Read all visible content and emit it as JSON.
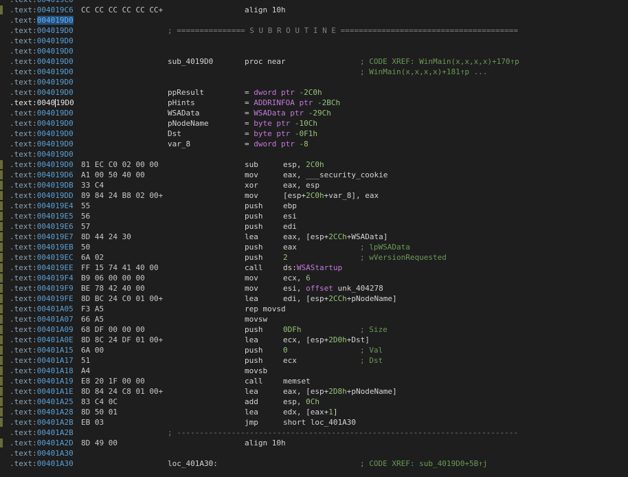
{
  "listing": {
    "segment": ".text:",
    "lines": [
      {
        "addr": "004019C0",
        "bytes": "",
        "label": "",
        "mnem": "",
        "ops": "",
        "cmt": "",
        "partial": true
      },
      {
        "addr": "004019C6",
        "bytes": "CC CC CC CC CC CC+",
        "mnem": "align 10h",
        "code": true
      },
      {
        "addr": "004019D0",
        "sel": true
      },
      {
        "addr": "004019D0",
        "sep": "; =============== S U B R O U T I N E ======================================="
      },
      {
        "addr": "004019D0"
      },
      {
        "addr": "004019D0"
      },
      {
        "addr": "004019D0",
        "label": "sub_4019D0",
        "mnem": "proc near",
        "cmt": "; CODE XREF: WinMain(x,x,x,x)+170↑p"
      },
      {
        "addr": "004019D0",
        "cmt": "; WinMain(x,x,x,x)+181↑p ..."
      },
      {
        "addr": "004019D0"
      },
      {
        "addr": "004019D0",
        "label": "ppResult",
        "mnem": "= dword ptr -2C0h",
        "mnemCls": "o-sym"
      },
      {
        "addr": "004019D0",
        "label": "pHints",
        "mnem": "= ADDRINFOA ptr -2BCh",
        "mnemCls": "o-sym",
        "current": true
      },
      {
        "addr": "004019D0",
        "label": "WSAData",
        "mnem": "= WSAData ptr -29Ch",
        "mnemCls": "o-sym"
      },
      {
        "addr": "004019D0",
        "label": "pNodeName",
        "mnem": "= byte ptr -10Ch",
        "mnemCls": "o-sym"
      },
      {
        "addr": "004019D0",
        "label": "Dst",
        "mnem": "= byte ptr -0F1h",
        "mnemCls": "o-sym"
      },
      {
        "addr": "004019D0",
        "label": "var_8",
        "mnem": "= dword ptr -8",
        "mnemCls": "o-sym"
      },
      {
        "addr": "004019D0"
      },
      {
        "addr": "004019D0",
        "bytes": "81 EC C0 02 00 00",
        "mnem": "sub",
        "ops": "esp, 2C0h",
        "code": true
      },
      {
        "addr": "004019D6",
        "bytes": "A1 00 50 40 00",
        "mnem": "mov",
        "ops": "eax, ___security_cookie",
        "code": true
      },
      {
        "addr": "004019DB",
        "bytes": "33 C4",
        "mnem": "xor",
        "ops": "eax, esp",
        "code": true
      },
      {
        "addr": "004019DD",
        "bytes": "89 84 24 B8 02 00+",
        "mnem": "mov",
        "ops": "[esp+2C0h+var_8], eax",
        "code": true
      },
      {
        "addr": "004019E4",
        "bytes": "55",
        "mnem": "push",
        "ops": "ebp",
        "code": true
      },
      {
        "addr": "004019E5",
        "bytes": "56",
        "mnem": "push",
        "ops": "esi",
        "code": true
      },
      {
        "addr": "004019E6",
        "bytes": "57",
        "mnem": "push",
        "ops": "edi",
        "code": true
      },
      {
        "addr": "004019E7",
        "bytes": "8D 44 24 30",
        "mnem": "lea",
        "ops": "eax, [esp+2CCh+WSAData]",
        "code": true
      },
      {
        "addr": "004019EB",
        "bytes": "50",
        "mnem": "push",
        "ops": "eax",
        "cmt": "; lpWSAData",
        "code": true
      },
      {
        "addr": "004019EC",
        "bytes": "6A 02",
        "mnem": "push",
        "ops": "2",
        "cmt": "; wVersionRequested",
        "code": true
      },
      {
        "addr": "004019EE",
        "bytes": "FF 15 74 41 40 00",
        "mnem": "call",
        "ops": "ds:WSAStartup",
        "code": true
      },
      {
        "addr": "004019F4",
        "bytes": "B9 06 00 00 00",
        "mnem": "mov",
        "ops": "ecx, 6",
        "code": true
      },
      {
        "addr": "004019F9",
        "bytes": "BE 78 42 40 00",
        "mnem": "mov",
        "ops": "esi, offset unk_404278",
        "code": true
      },
      {
        "addr": "004019FE",
        "bytes": "8D BC 24 C0 01 00+",
        "mnem": "lea",
        "ops": "edi, [esp+2CCh+pNodeName]",
        "code": true
      },
      {
        "addr": "00401A05",
        "bytes": "F3 A5",
        "mnem": "rep movsd",
        "ops": "",
        "code": true
      },
      {
        "addr": "00401A07",
        "bytes": "66 A5",
        "mnem": "movsw",
        "ops": "",
        "code": true
      },
      {
        "addr": "00401A09",
        "bytes": "68 DF 00 00 00",
        "mnem": "push",
        "ops": "0DFh",
        "cmt": "; Size",
        "code": true
      },
      {
        "addr": "00401A0E",
        "bytes": "8D 8C 24 DF 01 00+",
        "mnem": "lea",
        "ops": "ecx, [esp+2D0h+Dst]",
        "code": true
      },
      {
        "addr": "00401A15",
        "bytes": "6A 00",
        "mnem": "push",
        "ops": "0",
        "cmt": "; Val",
        "code": true
      },
      {
        "addr": "00401A17",
        "bytes": "51",
        "mnem": "push",
        "ops": "ecx",
        "cmt": "; Dst",
        "code": true
      },
      {
        "addr": "00401A18",
        "bytes": "A4",
        "mnem": "movsb",
        "ops": "",
        "code": true
      },
      {
        "addr": "00401A19",
        "bytes": "E8 20 1F 00 00",
        "mnem": "call",
        "ops": "memset",
        "code": true
      },
      {
        "addr": "00401A1E",
        "bytes": "8D 84 24 C8 01 00+",
        "mnem": "lea",
        "ops": "eax, [esp+2D8h+pNodeName]",
        "code": true
      },
      {
        "addr": "00401A25",
        "bytes": "83 C4 0C",
        "mnem": "add",
        "ops": "esp, 0Ch",
        "code": true
      },
      {
        "addr": "00401A28",
        "bytes": "8D 50 01",
        "mnem": "lea",
        "ops": "edx, [eax+1]",
        "code": true
      },
      {
        "addr": "00401A2B",
        "bytes": "EB 03",
        "mnem": "jmp",
        "ops": "short loc_401A30",
        "code": true
      },
      {
        "addr": "00401A2B",
        "sep": "; ---------------------------------------------------------------------------"
      },
      {
        "addr": "00401A2D",
        "bytes": "8D 49 00",
        "mnem": "align 10h",
        "code": true
      },
      {
        "addr": "00401A30"
      },
      {
        "addr": "00401A30",
        "label": "loc_401A30:",
        "cmt": "; CODE XREF: sub_4019D0+5B↑j"
      }
    ]
  },
  "colors": {
    "background": "#1e1e1e",
    "address": "#5a9fd4",
    "selection": "#264f78",
    "comment": "#6a9955",
    "number": "#98c379",
    "symbol": "#c678dd"
  }
}
